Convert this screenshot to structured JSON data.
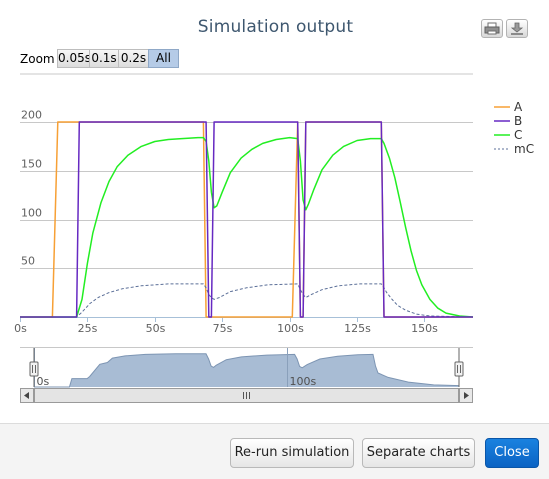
{
  "dialog": {
    "title": "Simulation output",
    "print_icon": "printer-icon",
    "download_icon": "download-icon"
  },
  "zoom": {
    "label": "Zoom",
    "buttons": [
      "0.05s",
      "0.1s",
      "0.2s",
      "All"
    ],
    "selected": "All"
  },
  "footer": {
    "rerun_label": "Re-run simulation",
    "separate_label": "Separate charts",
    "close_label": "Close"
  },
  "colors": {
    "A": "#f7a035",
    "B": "#6629c2",
    "C": "#22ee22",
    "mC": "#5b6f98",
    "grid": "#c8c8c8",
    "navigator_fill": "#a8bcd4",
    "navigator_line": "#7d95b3",
    "primary": "#0b6ed0"
  },
  "chart_data": {
    "type": "line",
    "xlabel": "",
    "ylabel": "",
    "x_range": [
      0,
      168
    ],
    "ylim": [
      0,
      200
    ],
    "x_ticks": [
      "0s",
      "25s",
      "50s",
      "75s",
      "100s",
      "125s",
      "150s"
    ],
    "y_ticks": [
      "50",
      "100",
      "150",
      "200"
    ],
    "grid": true,
    "legend_position": "right",
    "series": [
      {
        "name": "A",
        "style": "solid",
        "points": [
          [
            0,
            0
          ],
          [
            12,
            0
          ],
          [
            14,
            200
          ],
          [
            68,
            200
          ],
          [
            69,
            0
          ],
          [
            101,
            0
          ],
          [
            103,
            200
          ],
          [
            104,
            0
          ],
          [
            105,
            0
          ],
          [
            106,
            200
          ],
          [
            134,
            200
          ],
          [
            135,
            0
          ],
          [
            168,
            0
          ]
        ]
      },
      {
        "name": "B",
        "style": "solid",
        "points": [
          [
            0,
            0
          ],
          [
            21,
            0
          ],
          [
            22,
            200
          ],
          [
            69,
            200
          ],
          [
            70,
            0
          ],
          [
            71,
            0
          ],
          [
            72,
            200
          ],
          [
            103,
            200
          ],
          [
            104,
            0
          ],
          [
            105,
            0
          ],
          [
            106,
            200
          ],
          [
            134,
            200
          ],
          [
            135,
            0
          ],
          [
            168,
            0
          ]
        ]
      },
      {
        "name": "C",
        "style": "solid",
        "points": [
          [
            0,
            0
          ],
          [
            21,
            0
          ],
          [
            23,
            18
          ],
          [
            25,
            55
          ],
          [
            27,
            86
          ],
          [
            30,
            117
          ],
          [
            33,
            139
          ],
          [
            36,
            154
          ],
          [
            40,
            166
          ],
          [
            45,
            175
          ],
          [
            50,
            180
          ],
          [
            55,
            182
          ],
          [
            60,
            183
          ],
          [
            66,
            184
          ],
          [
            68,
            184
          ],
          [
            69,
            180
          ],
          [
            70,
            160
          ],
          [
            71,
            128
          ],
          [
            72,
            112
          ],
          [
            73,
            114
          ],
          [
            75,
            128
          ],
          [
            78,
            148
          ],
          [
            82,
            163
          ],
          [
            86,
            172
          ],
          [
            90,
            178
          ],
          [
            95,
            182
          ],
          [
            100,
            184
          ],
          [
            103,
            183
          ],
          [
            104,
            160
          ],
          [
            105,
            120
          ],
          [
            106,
            110
          ],
          [
            107,
            116
          ],
          [
            109,
            131
          ],
          [
            112,
            151
          ],
          [
            116,
            166
          ],
          [
            120,
            175
          ],
          [
            125,
            181
          ],
          [
            130,
            183
          ],
          [
            134,
            183
          ],
          [
            135,
            178
          ],
          [
            137,
            163
          ],
          [
            139,
            143
          ],
          [
            141,
            118
          ],
          [
            143,
            92
          ],
          [
            145,
            68
          ],
          [
            147,
            48
          ],
          [
            149,
            33
          ],
          [
            152,
            18
          ],
          [
            155,
            9
          ],
          [
            158,
            4
          ],
          [
            163,
            1
          ],
          [
            168,
            0
          ]
        ]
      },
      {
        "name": "mC",
        "style": "dash",
        "points": [
          [
            0,
            0
          ],
          [
            21,
            0
          ],
          [
            23,
            5
          ],
          [
            26,
            14
          ],
          [
            29,
            20
          ],
          [
            33,
            25
          ],
          [
            38,
            29
          ],
          [
            45,
            32
          ],
          [
            55,
            34
          ],
          [
            68,
            34
          ],
          [
            69,
            30
          ],
          [
            70,
            23
          ],
          [
            71,
            20
          ],
          [
            72,
            18
          ],
          [
            74,
            20
          ],
          [
            78,
            26
          ],
          [
            84,
            30
          ],
          [
            92,
            33
          ],
          [
            103,
            34
          ],
          [
            104,
            28
          ],
          [
            105,
            23
          ],
          [
            106,
            20
          ],
          [
            108,
            23
          ],
          [
            112,
            28
          ],
          [
            118,
            32
          ],
          [
            126,
            34
          ],
          [
            134,
            34
          ],
          [
            135,
            30
          ],
          [
            136,
            25
          ],
          [
            138,
            18
          ],
          [
            140,
            12
          ],
          [
            143,
            7
          ],
          [
            147,
            3
          ],
          [
            152,
            1
          ],
          [
            168,
            0
          ]
        ]
      }
    ],
    "navigator": {
      "x_range": [
        0,
        168
      ],
      "ylim": [
        0,
        200
      ],
      "tick_labels": [
        {
          "x": 0,
          "label": "0s"
        },
        {
          "x": 100,
          "label": "100s"
        }
      ],
      "points": [
        [
          0,
          0
        ],
        [
          14,
          0
        ],
        [
          15,
          48
        ],
        [
          21,
          48
        ],
        [
          22,
          60
        ],
        [
          26,
          130
        ],
        [
          29,
          140
        ],
        [
          31,
          165
        ],
        [
          36,
          178
        ],
        [
          44,
          186
        ],
        [
          56,
          190
        ],
        [
          68,
          190
        ],
        [
          69,
          160
        ],
        [
          70,
          120
        ],
        [
          71,
          112
        ],
        [
          72,
          124
        ],
        [
          76,
          156
        ],
        [
          82,
          172
        ],
        [
          92,
          182
        ],
        [
          103,
          186
        ],
        [
          104,
          160
        ],
        [
          105,
          118
        ],
        [
          106,
          110
        ],
        [
          108,
          128
        ],
        [
          113,
          160
        ],
        [
          120,
          176
        ],
        [
          128,
          184
        ],
        [
          134,
          186
        ],
        [
          135,
          120
        ],
        [
          136,
          80
        ],
        [
          140,
          55
        ],
        [
          148,
          28
        ],
        [
          158,
          12
        ],
        [
          168,
          8
        ]
      ]
    }
  }
}
